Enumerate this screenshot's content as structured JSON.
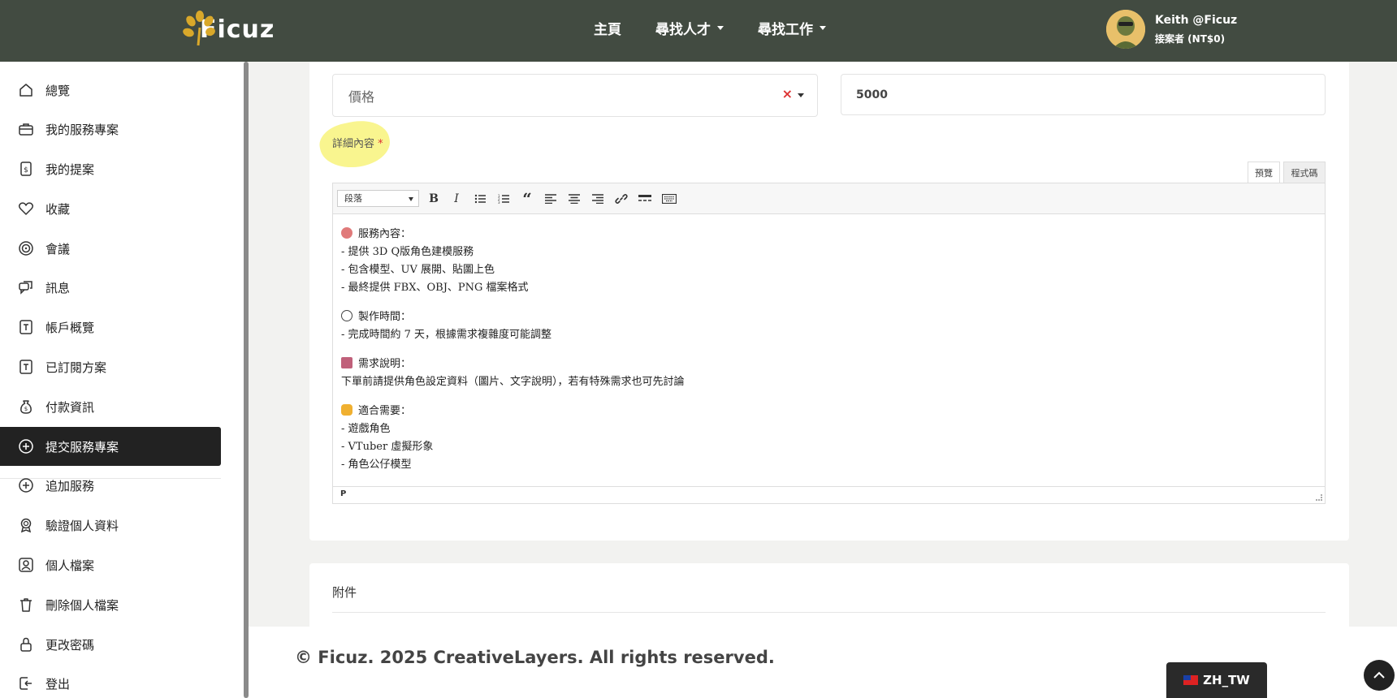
{
  "brand": {
    "name": "Ficuz"
  },
  "nav": {
    "home": "主頁",
    "find_talent": "尋找人才",
    "find_work": "尋找工作"
  },
  "user": {
    "name": "Keith @Ficuz",
    "role": "接案者 (NT$0)"
  },
  "sidebar": {
    "items": [
      {
        "label": "總覽",
        "icon": "home-icon"
      },
      {
        "label": "我的服務專案",
        "icon": "briefcase-icon"
      },
      {
        "label": "我的提案",
        "icon": "dollar-file-icon"
      },
      {
        "label": "收藏",
        "icon": "heart-icon"
      },
      {
        "label": "會議",
        "icon": "target-icon"
      },
      {
        "label": "訊息",
        "icon": "chat-icon"
      },
      {
        "label": "帳戶概覽",
        "icon": "account-icon"
      },
      {
        "label": "已訂閱方案",
        "icon": "plan-icon"
      },
      {
        "label": "付款資訊",
        "icon": "money-bag-icon"
      },
      {
        "label": "提交服務專案",
        "icon": "plus-circle-icon",
        "active": true
      },
      {
        "label": "追加服務",
        "icon": "plus-circle-icon"
      },
      {
        "label": "驗證個人資料",
        "icon": "badge-icon"
      },
      {
        "label": "個人檔案",
        "icon": "profile-icon"
      },
      {
        "label": "刪除個人檔案",
        "icon": "trash-icon"
      },
      {
        "label": "更改密碼",
        "icon": "lock-icon"
      },
      {
        "label": "登出",
        "icon": "logout-icon"
      }
    ]
  },
  "form": {
    "pricing_type_value": "價格",
    "price_value": "5000",
    "detail_label": "詳細內容",
    "required_mark": "*"
  },
  "editor": {
    "tabs": {
      "preview": "預覽",
      "code": "程式碼"
    },
    "format_select": "段落",
    "status_path": "P",
    "sections": [
      {
        "emoji": "palette",
        "emoji_color": "#e07a7a",
        "heading": "服務內容：",
        "lines": [
          "- 提供 3D Q版角色建模服務",
          "- 包含模型、UV 展開、貼圖上色",
          "- 最終提供 FBX、OBJ、PNG 檔案格式"
        ]
      },
      {
        "emoji": "clock",
        "emoji_color": "#444444",
        "heading": "製作時間：",
        "lines": [
          "- 完成時間約 7 天，根據需求複雜度可能調整"
        ]
      },
      {
        "emoji": "inbox",
        "emoji_color": "#c0607a",
        "heading": "需求說明：",
        "lines": [
          "下單前請提供角色設定資料（圖片、文字說明），若有特殊需求也可先討論"
        ]
      },
      {
        "emoji": "thumbs-up",
        "emoji_color": "#f0b030",
        "heading": "適合需要：",
        "lines": [
          "- 遊戲角色",
          "- VTuber 虛擬形象",
          "- 角色公仔模型"
        ]
      }
    ]
  },
  "attachments": {
    "title": "附件"
  },
  "footer": {
    "copyright": "© Ficuz. 2025 CreativeLayers. All rights reserved.",
    "language": "ZH_TW"
  },
  "colors": {
    "topbar": "#424b41",
    "active_sidebar": "#222222",
    "highlight": "#f7f26a",
    "required": "#dd3333"
  }
}
